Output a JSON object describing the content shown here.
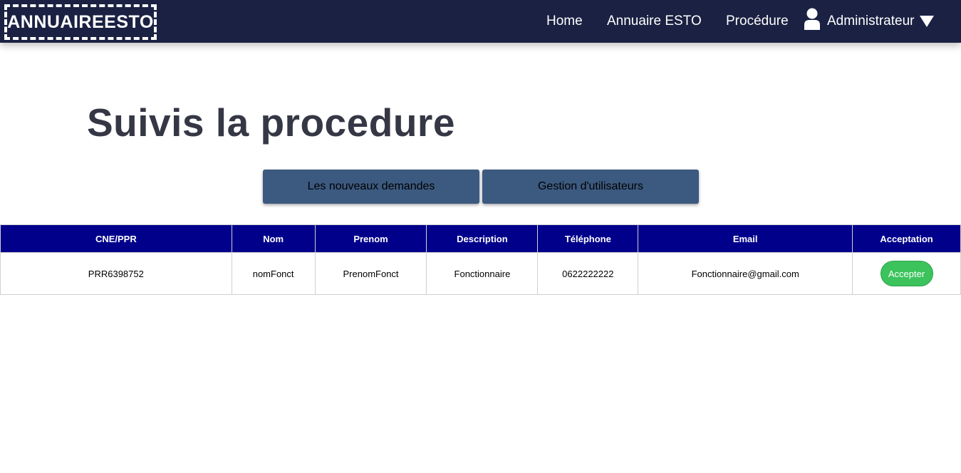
{
  "navbar": {
    "logo": "ANNUAIREESTO",
    "links": [
      "Home",
      "Annuaire ESTO",
      "Procédure"
    ],
    "user_label": "Administrateur"
  },
  "page_title": "Suivis la procedure",
  "tabs": [
    "Les nouveaux demandes",
    "Gestion d'utilisateurs"
  ],
  "table": {
    "headers": [
      "CNE/PPR",
      "Nom",
      "Prenom",
      "Description",
      "Téléphone",
      "Email",
      "Acceptation"
    ],
    "rows": [
      {
        "cne": "PRR6398752",
        "nom": "nomFonct",
        "prenom": "PrenomFonct",
        "description": "Fonctionnaire",
        "telephone": "0622222222",
        "email": "Fonctionnaire@gmail.com",
        "action_label": "Accepter"
      }
    ]
  },
  "colors": {
    "navbar_bg": "#1a2142",
    "tab_bg": "#3c5a80",
    "table_header_bg": "#00008b",
    "accept_bg": "#3cc35c",
    "title": "#353745"
  },
  "icons": {
    "user": "user-icon",
    "dropdown": "caret-down-icon"
  }
}
